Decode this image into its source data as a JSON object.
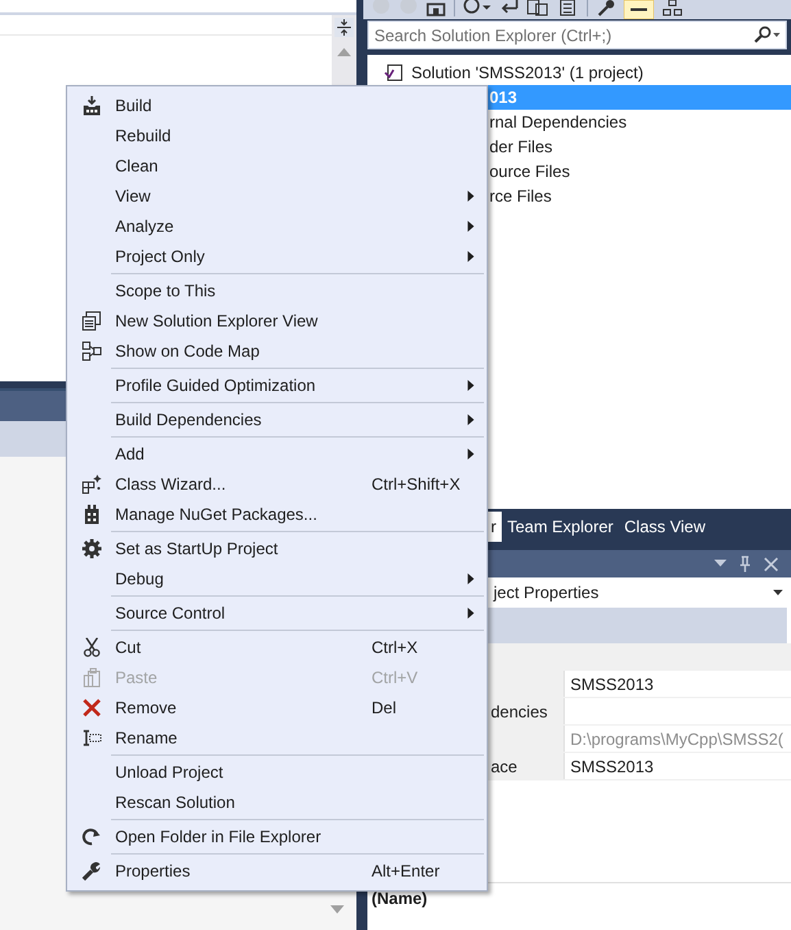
{
  "solution_explorer": {
    "search": {
      "placeholder": "Search Solution Explorer (Ctrl+;)"
    },
    "tree": [
      {
        "label": "Solution 'SMSS2013' (1 project)",
        "selected": false,
        "children": [
          {
            "label": "013",
            "selected": true,
            "children": [
              {
                "label": "rnal Dependencies",
                "selected": false
              },
              {
                "label": "der Files",
                "selected": false
              },
              {
                "label": "ource Files",
                "selected": false
              },
              {
                "label": "rce Files",
                "selected": false
              }
            ]
          }
        ]
      }
    ]
  },
  "tool_tabs": [
    {
      "label": "r",
      "selected": true
    },
    {
      "label": "Team Explorer",
      "selected": false
    },
    {
      "label": "Class View",
      "selected": false
    }
  ],
  "properties": {
    "object": "ject Properties",
    "rows": [
      {
        "value": "SMSS2013",
        "disabled": false
      },
      {
        "name": "dencies"
      },
      {
        "value": "D:\\programs\\MyCpp\\SMSS2(",
        "disabled": true
      },
      {
        "name": "ace",
        "value": "SMSS2013",
        "disabled": false
      }
    ],
    "description_title": "(Name)"
  },
  "context_menu": [
    [
      {
        "label": "Build",
        "submenu": false,
        "disabled": false
      },
      {
        "label": "Rebuild",
        "submenu": false,
        "disabled": false
      },
      {
        "label": "Clean",
        "submenu": false,
        "disabled": false
      },
      {
        "label": "View",
        "submenu": true,
        "disabled": false
      },
      {
        "label": "Analyze",
        "submenu": true,
        "disabled": false
      },
      {
        "label": "Project Only",
        "submenu": true,
        "disabled": false
      }
    ],
    [
      {
        "label": "Scope to This",
        "submenu": false,
        "disabled": false
      },
      {
        "label": "New Solution Explorer View",
        "submenu": false,
        "disabled": false
      },
      {
        "label": "Show on Code Map",
        "submenu": false,
        "disabled": false
      }
    ],
    [
      {
        "label": "Profile Guided Optimization",
        "submenu": true,
        "disabled": false
      }
    ],
    [
      {
        "label": "Build Dependencies",
        "submenu": true,
        "disabled": false
      }
    ],
    [
      {
        "label": "Add",
        "submenu": true,
        "disabled": false
      },
      {
        "label": "Class Wizard...",
        "shortcut": "Ctrl+Shift+X",
        "submenu": false,
        "disabled": false
      },
      {
        "label": "Manage NuGet Packages...",
        "submenu": false,
        "disabled": false
      }
    ],
    [
      {
        "label": "Set as StartUp Project",
        "submenu": false,
        "disabled": false
      },
      {
        "label": "Debug",
        "submenu": true,
        "disabled": false
      }
    ],
    [
      {
        "label": "Source Control",
        "submenu": true,
        "disabled": false
      }
    ],
    [
      {
        "label": "Cut",
        "shortcut": "Ctrl+X",
        "submenu": false,
        "disabled": false
      },
      {
        "label": "Paste",
        "shortcut": "Ctrl+V",
        "submenu": false,
        "disabled": true
      },
      {
        "label": "Remove",
        "shortcut": "Del",
        "submenu": false,
        "disabled": false
      },
      {
        "label": "Rename",
        "submenu": false,
        "disabled": false
      }
    ],
    [
      {
        "label": "Unload Project",
        "submenu": false,
        "disabled": false
      },
      {
        "label": "Rescan Solution",
        "submenu": false,
        "disabled": false
      }
    ],
    [
      {
        "label": "Open Folder in File Explorer",
        "submenu": false,
        "disabled": false
      }
    ],
    [
      {
        "label": "Properties",
        "shortcut": "Alt+Enter",
        "submenu": false,
        "disabled": false
      }
    ]
  ]
}
